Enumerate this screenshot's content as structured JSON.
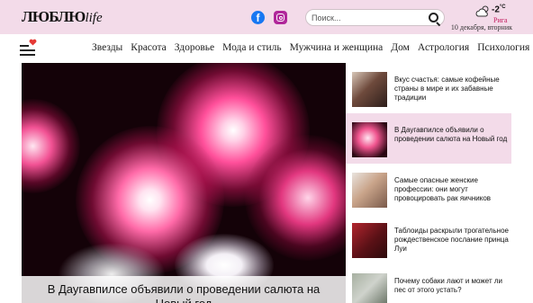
{
  "header": {
    "logo_main": "ЛЮБЛЮ",
    "logo_suffix": "life",
    "facebook_glyph": "f",
    "search_placeholder": "Поиск...",
    "weather": {
      "temperature": "-2",
      "unit": "°C",
      "city": "Рига"
    },
    "date": "10 декабря, вторник"
  },
  "nav": {
    "items": [
      "Звезды",
      "Красота",
      "Здоровье",
      "Мода и стиль",
      "Мужчина и женщина",
      "Дом",
      "Астрология",
      "Психология"
    ]
  },
  "hero": {
    "title": "В Даугавпилсе объявили о проведении салюта на Новый год"
  },
  "sidebar": {
    "articles": [
      {
        "title": "Вкус счастья: самые кофейные страны в мире и их забавные традиции",
        "active": false
      },
      {
        "title": "В Даугавпилсе объявили о проведении салюта на Новый год",
        "active": true
      },
      {
        "title": "Самые опасные женские профессии: они могут провоцировать рак яичников",
        "active": false
      },
      {
        "title": "Таблоиды раскрыли трогательное рождественское послание принца Луи",
        "active": false
      },
      {
        "title": "Почему собаки лают и может ли пес от этого устать?",
        "active": false
      }
    ]
  },
  "colors": {
    "header_bg": "#f3dbe9",
    "accent_city": "#c2185b",
    "facebook": "#1877f2",
    "instagram": "#b0279a",
    "heart": "#e53935"
  },
  "icons": [
    "facebook-icon",
    "instagram-icon",
    "search-icon",
    "cloud-sun-icon",
    "burger-menu-icon",
    "heart-icon"
  ]
}
